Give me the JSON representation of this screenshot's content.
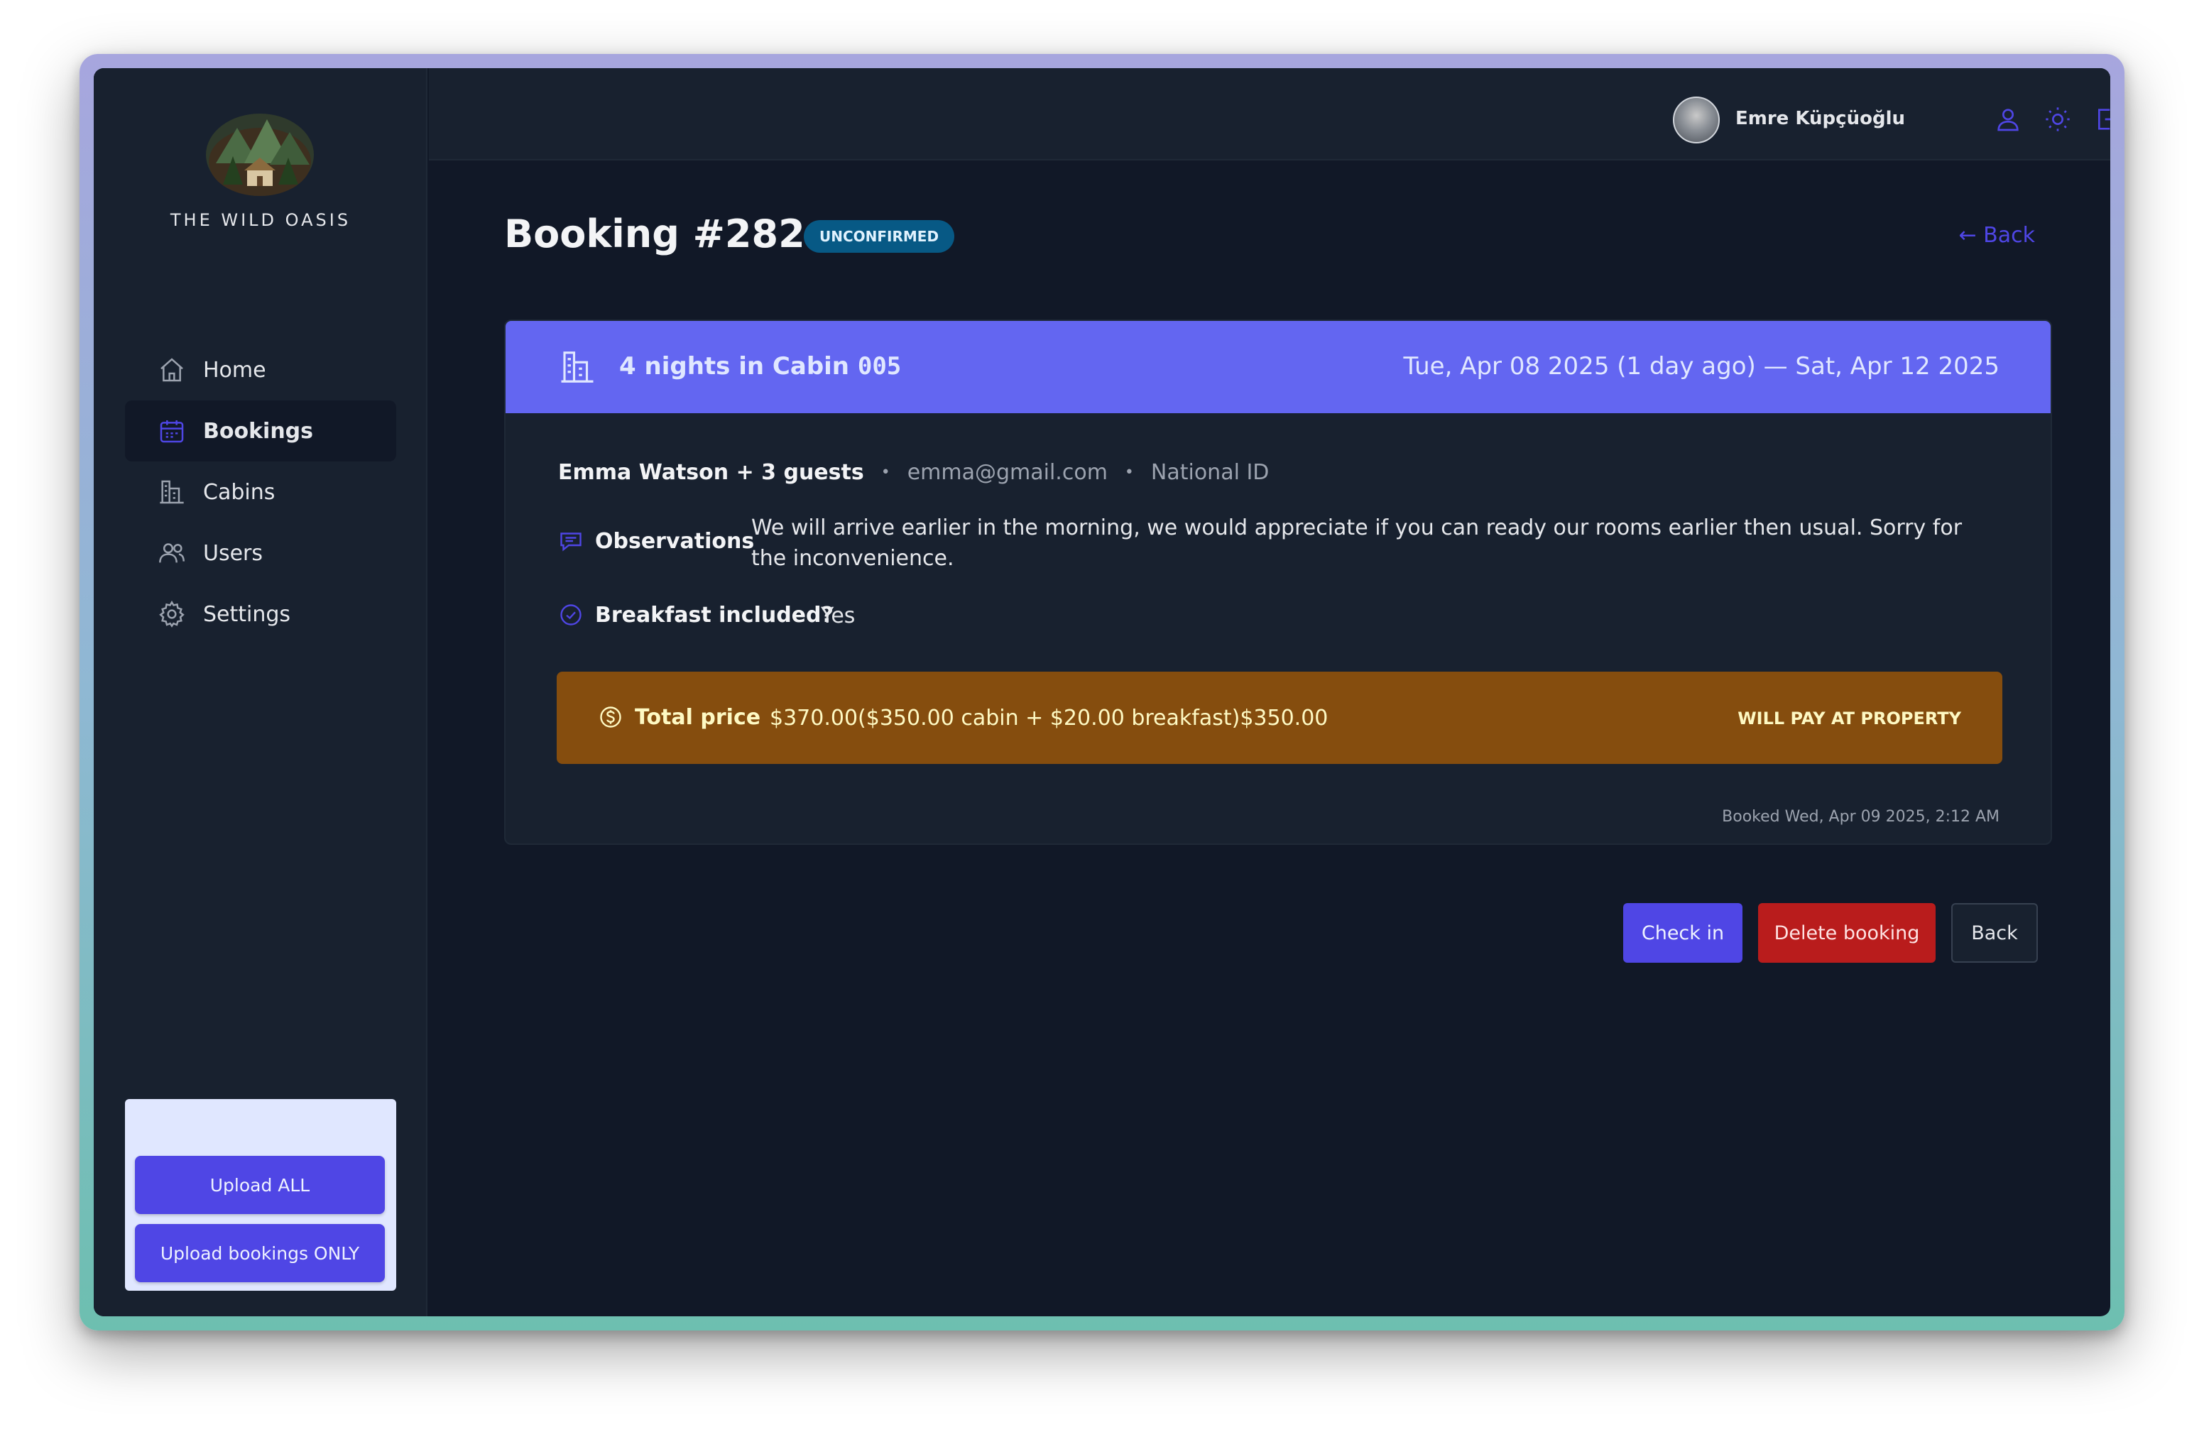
{
  "brand": {
    "name": "THE WILD OASIS"
  },
  "sidebar": {
    "items": [
      {
        "label": "Home",
        "icon": "home-icon"
      },
      {
        "label": "Bookings",
        "icon": "calendar-icon",
        "active": true
      },
      {
        "label": "Cabins",
        "icon": "building-icon"
      },
      {
        "label": "Users",
        "icon": "users-icon"
      },
      {
        "label": "Settings",
        "icon": "gear-icon"
      }
    ],
    "uploader": {
      "upload_all": "Upload ALL",
      "upload_bookings": "Upload bookings ONLY"
    }
  },
  "header": {
    "username": "Emre Küpçüoğlu",
    "icons": [
      "user-icon",
      "sun-icon",
      "logout-icon"
    ]
  },
  "booking": {
    "title": "Booking #282",
    "status": "UNCONFIRMED",
    "back_link": "← Back",
    "nights_text": "4 nights in Cabin ",
    "cabin_code": "005",
    "dates": "Tue, Apr 08 2025 (1 day ago) — Sat, Apr 12 2025",
    "guest_name": "Emma Watson + 3 guests",
    "email": "emma@gmail.com",
    "national_id": "National ID",
    "observations_label": "Observations",
    "observations": "We will arrive earlier in the morning, we would appreciate if you can ready our rooms earlier then usual. Sorry for the inconvenience.",
    "breakfast_label": "Breakfast included?",
    "breakfast_value": "Yes",
    "price_label": "Total price",
    "price_text": "$370.00($350.00 cabin + $20.00 breakfast)$350.00",
    "payment_status": "WILL PAY AT PROPERTY",
    "booked_at": "Booked Wed, Apr 09 2025, 2:12 AM"
  },
  "actions": {
    "check_in": "Check in",
    "delete": "Delete booking",
    "back": "Back"
  },
  "colors": {
    "accent": "#4f46e5",
    "header_band": "#6366f1",
    "price_box": "#854d0e",
    "status_tag": "#075985",
    "danger": "#b91c1c"
  }
}
